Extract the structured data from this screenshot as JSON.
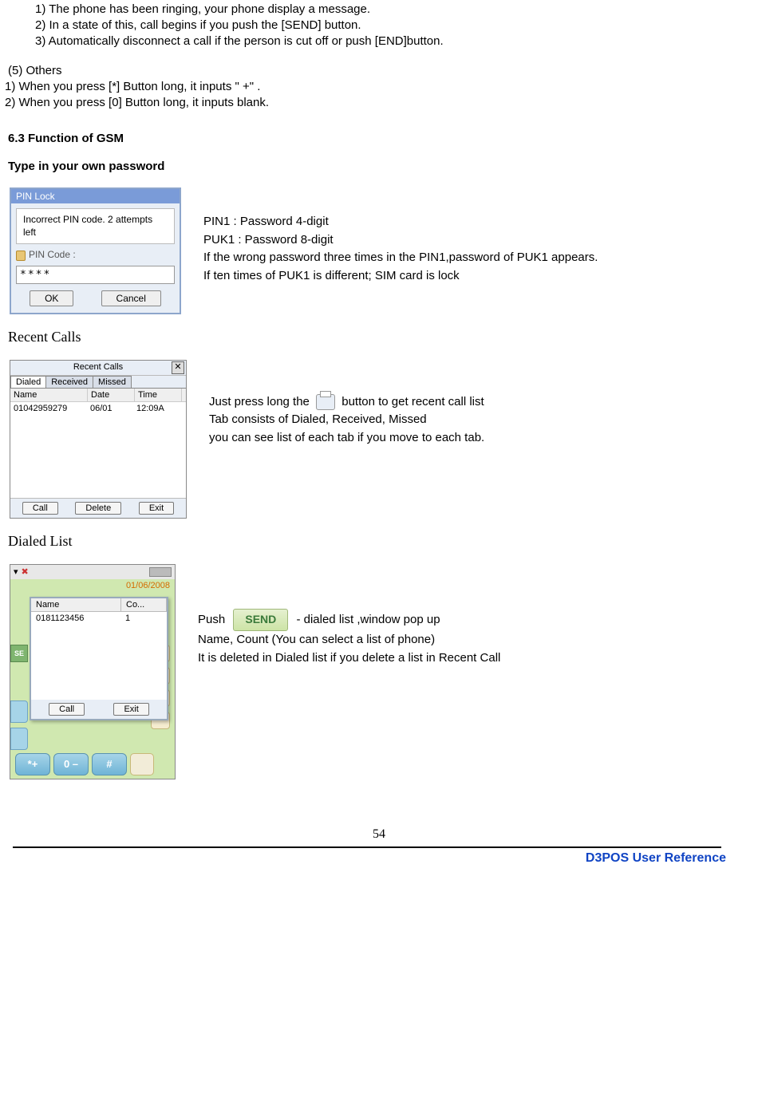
{
  "top": {
    "l1": "1) The phone has been ringing, your phone display a message.",
    "l2": "2) In a state of this, call begins if you push the [SEND] button.",
    "l3": "3) Automatically disconnect a call if the person is cut off or push [END]button."
  },
  "others": {
    "heading": "(5) Others",
    "l1": "1) When you press [*] Button long, it inputs \" +\" .",
    "l2": "2) When you press [0] Button long, it inputs blank."
  },
  "s63": "6.3 Function of GSM",
  "type_pw": "Type in your own password",
  "pinlock": {
    "title": "PIN Lock",
    "msg": "Incorrect PIN code. 2 attempts left",
    "label": "PIN Code :",
    "value": "****",
    "ok": "OK",
    "cancel": "Cancel"
  },
  "pin_desc": {
    "l1": "PIN1 : Password 4-digit",
    "l2": "PUK1 : Password 8-digit",
    "l3": "If the wrong password three times in the PIN1,password of PUK1 appears.",
    "l4": "If ten times of PUK1 is different; SIM card is lock"
  },
  "recent_heading": "Recent Calls",
  "recent": {
    "title": "Recent Calls",
    "tabs": {
      "dialed": "Dialed",
      "received": "Received",
      "missed": "Missed"
    },
    "headers": {
      "name": "Name",
      "date": "Date",
      "time": "Time"
    },
    "row": {
      "name": "01042959279",
      "date": "06/01",
      "time": "12:09A"
    },
    "btn_call": "Call",
    "btn_delete": "Delete",
    "btn_exit": "Exit"
  },
  "recent_desc": {
    "l1a": "Just press long the",
    "l1b": "button to get recent call list",
    "l2": "Tab consists of Dialed, Received, Missed",
    "l3": "you can see list of each tab if you move to each tab."
  },
  "dialed_heading": "Dialed List",
  "dialed": {
    "date": "01/06/2008",
    "se": "SE",
    "popup": {
      "h_name": "Name",
      "h_co": "Co...",
      "row_name": "0181123456",
      "row_co": "1",
      "btn_call": "Call",
      "btn_exit": "Exit"
    },
    "keys": {
      "star": "*+",
      "zero": "0 –",
      "hash": "#"
    }
  },
  "dialed_desc": {
    "push": "Push",
    "send": "SEND",
    "l1b": "- dialed list ,window pop up",
    "l2": "Name, Count   (You can select a list of phone)",
    "l3": "It is deleted in Dialed list if you delete a list in Recent Call"
  },
  "footer": {
    "page": "54",
    "ref": "D3POS User Reference"
  }
}
